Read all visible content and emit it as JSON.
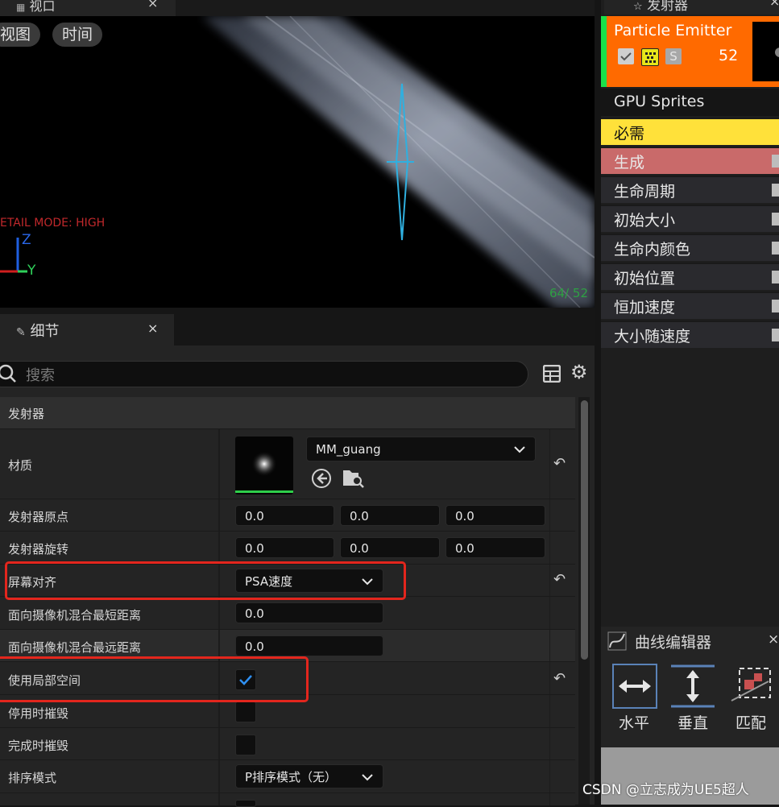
{
  "viewport": {
    "tab_title": "视口",
    "tab_close": "×",
    "view_button": "视图",
    "time_button": "时间",
    "detail_mode": "ETAIL MODE: HIGH",
    "axis_z": "Z",
    "axis_y": "Y",
    "fps": "64/ 52"
  },
  "details": {
    "tab_title": "细节",
    "tab_close": "×",
    "search_placeholder": "搜索",
    "category": "发射器",
    "material": {
      "label": "材质",
      "value": "MM_guang"
    },
    "origin": {
      "label": "发射器原点",
      "x": "0.0",
      "y": "0.0",
      "z": "0.0"
    },
    "rotation": {
      "label": "发射器旋转",
      "x": "0.0",
      "y": "0.0",
      "z": "0.0"
    },
    "screen_alignment": {
      "label": "屏幕对齐",
      "value": "PSA速度"
    },
    "camera_min": {
      "label": "面向摄像机混合最短距离",
      "value": "0.0"
    },
    "camera_max": {
      "label": "面向摄像机混合最远距离",
      "value": "0.0"
    },
    "local_space": {
      "label": "使用局部空间",
      "checked": true
    },
    "kill_on_deactivate": {
      "label": "停用时摧毁",
      "checked": false
    },
    "kill_on_completed": {
      "label": "完成时摧毁",
      "checked": false
    },
    "sort_mode": {
      "label": "排序模式",
      "value": "P排序模式（无）"
    }
  },
  "emitter": {
    "tab_title": "发射器",
    "tab_close": "×",
    "name": "Particle Emitter",
    "solo": "S",
    "count": "52",
    "type_data": "GPU Sprites",
    "modules": [
      "必需",
      "生成",
      "生命周期",
      "初始大小",
      "生命内颜色",
      "初始位置",
      "恒加速度",
      "大小随速度"
    ],
    "module_colors": [
      "#ffe13a",
      "#c96a6a",
      "#2a2a2e",
      "#2a2a2e",
      "#2a2a2e",
      "#2a2a2e",
      "#2a2a2e",
      "#2a2a2e"
    ]
  },
  "curve_editor": {
    "title": "曲线编辑器",
    "close": "×",
    "horizontal": "水平",
    "vertical": "垂直",
    "fit": "匹配"
  },
  "watermark": "CSDN @立志成为UE5超人",
  "colors": {
    "emitter_header": "#ff6a00",
    "highlight_box": "#e3261d",
    "fps_text": "#2ea043"
  }
}
